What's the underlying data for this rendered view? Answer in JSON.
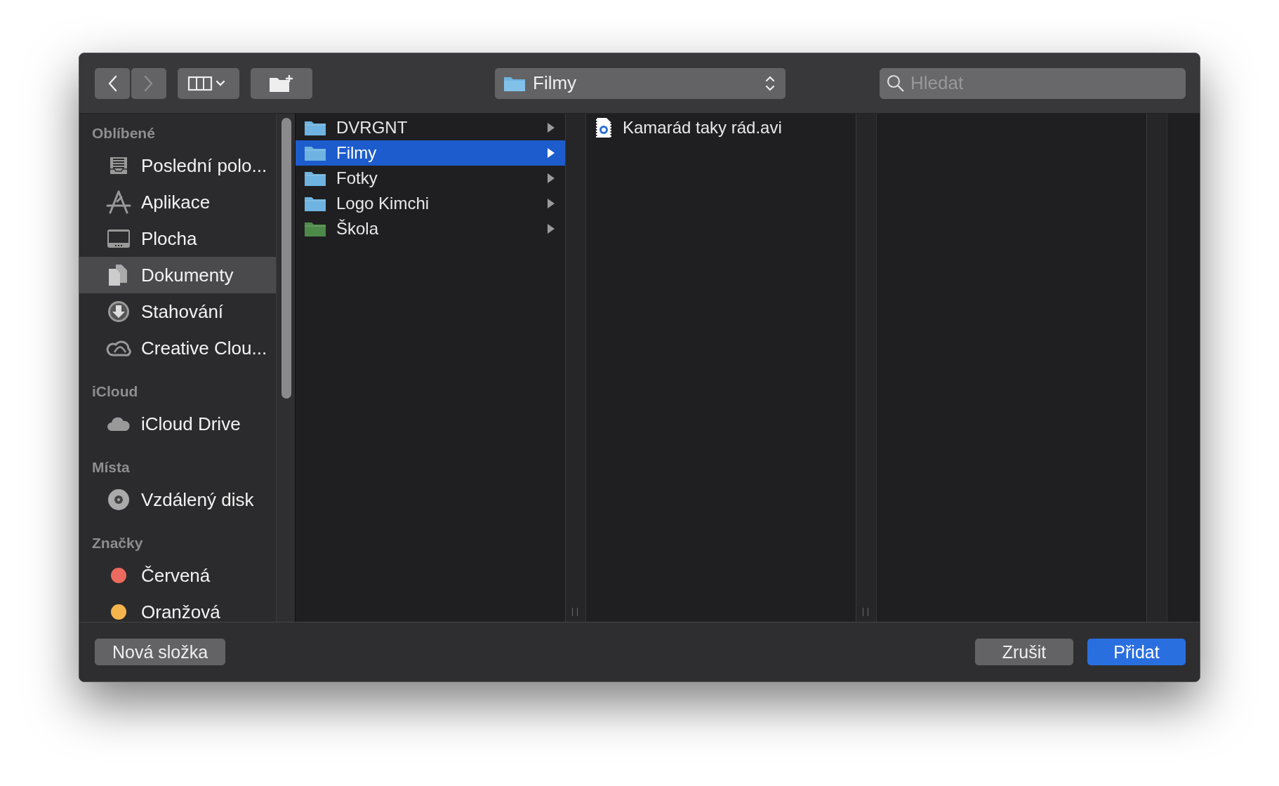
{
  "toolbar": {
    "back": {
      "disabled": false
    },
    "forward": {
      "disabled": true
    },
    "path_popup": {
      "label": "Filmy"
    },
    "search": {
      "placeholder": "Hledat"
    }
  },
  "sidebar": {
    "sections": [
      {
        "title": "Oblíbené",
        "items": [
          {
            "label": "Poslední polo...",
            "kind": "recents",
            "selected": false
          },
          {
            "label": "Aplikace",
            "kind": "apps",
            "selected": false
          },
          {
            "label": "Plocha",
            "kind": "desktop",
            "selected": false
          },
          {
            "label": "Dokumenty",
            "kind": "documents",
            "selected": true
          },
          {
            "label": "Stahování",
            "kind": "downloads",
            "selected": false
          },
          {
            "label": "Creative Clou...",
            "kind": "creativecloud",
            "selected": false
          }
        ]
      },
      {
        "title": "iCloud",
        "items": [
          {
            "label": "iCloud Drive",
            "kind": "cloud",
            "selected": false
          }
        ]
      },
      {
        "title": "Místa",
        "items": [
          {
            "label": "Vzdálený disk",
            "kind": "disk",
            "selected": false
          }
        ]
      },
      {
        "title": "Značky",
        "items": [
          {
            "label": "Červená",
            "kind": "tag",
            "color": "#ec6a5e",
            "selected": false
          },
          {
            "label": "Oranžová",
            "kind": "tag",
            "color": "#f5b54d",
            "selected": false
          }
        ]
      }
    ]
  },
  "columns": [
    {
      "items": [
        {
          "label": "DVRGNT",
          "kind": "folder",
          "color": "#6fb3e0",
          "selected": false
        },
        {
          "label": "Filmy",
          "kind": "folder",
          "color": "#6fb3e0",
          "selected": true
        },
        {
          "label": "Fotky",
          "kind": "folder",
          "color": "#6fb3e0",
          "selected": false
        },
        {
          "label": "Logo Kimchi",
          "kind": "folder",
          "color": "#6fb3e0",
          "selected": false
        },
        {
          "label": "Škola",
          "kind": "folder",
          "color": "#4e8a4a",
          "selected": false
        }
      ]
    },
    {
      "items": [
        {
          "label": "Kamarád taky rád.avi",
          "kind": "video",
          "selected": false
        }
      ]
    }
  ],
  "buttons": {
    "new_folder": "Nová složka",
    "cancel": "Zrušit",
    "confirm": "Přidat"
  }
}
